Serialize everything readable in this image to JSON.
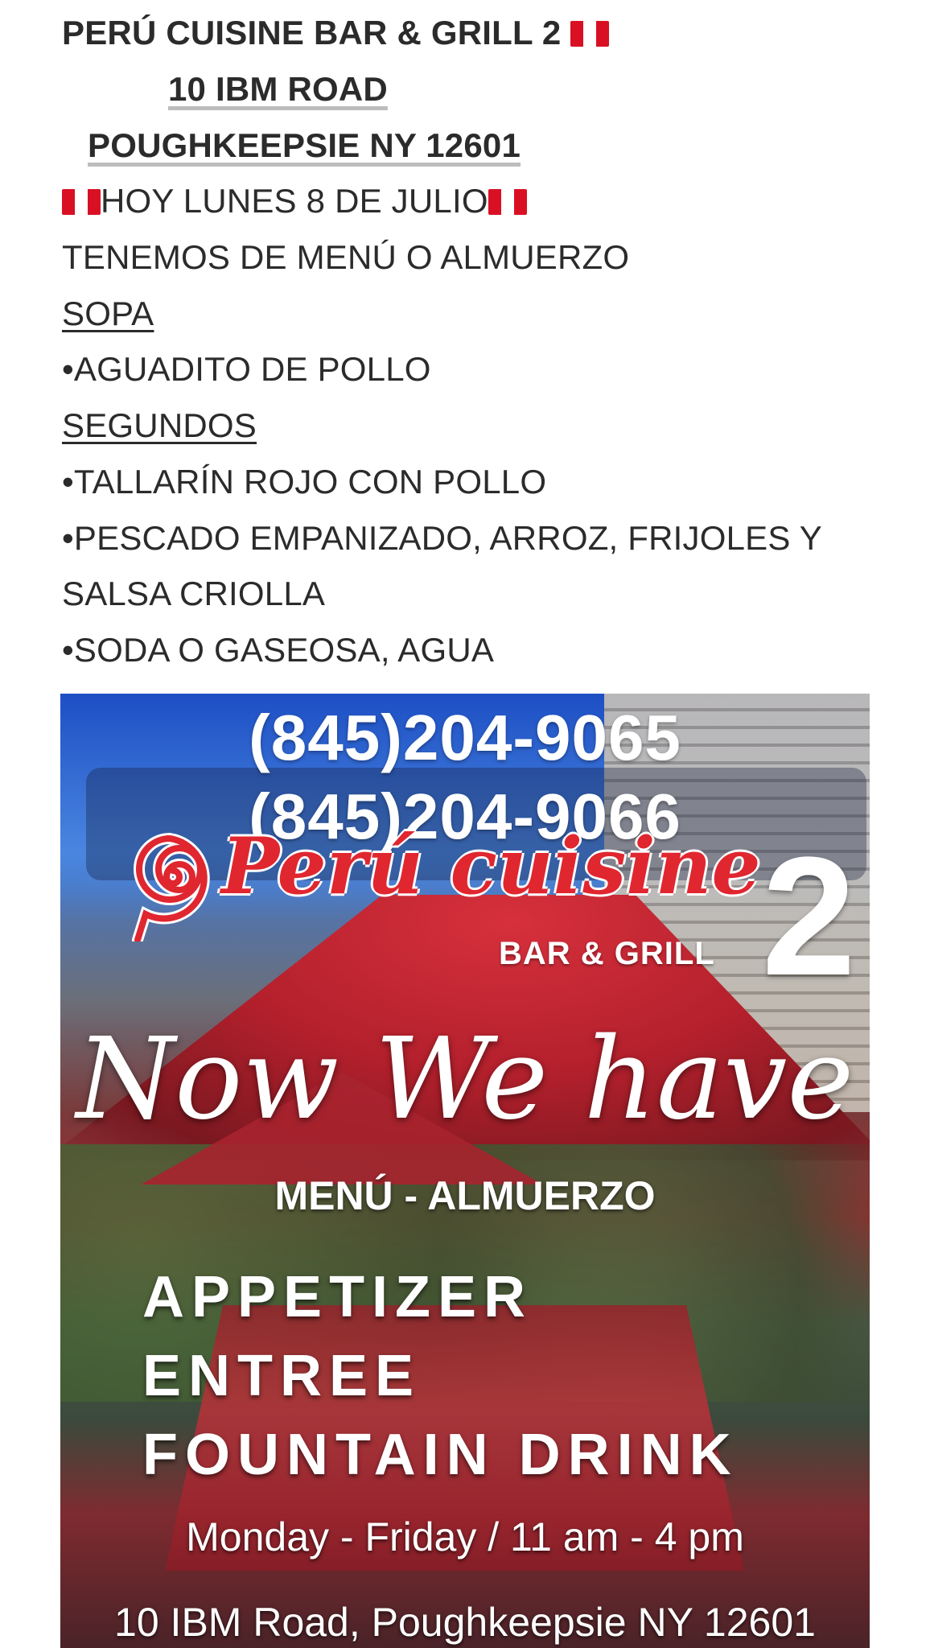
{
  "post": {
    "title": "PERÚ CUISINE BAR & GRILL 2",
    "address_line1": "10 IBM ROAD",
    "address_line2": "POUGHKEEPSIE NY 12601",
    "date_line": "HOY LUNES 8 DE JULIO",
    "intro": "TENEMOS DE MENÚ O ALMUERZO",
    "soup_heading": "SOPA",
    "soup_items": [
      "•AGUADITO DE POLLO"
    ],
    "seconds_heading": "SEGUNDOS",
    "seconds_items": [
      "•TALLARÍN ROJO CON POLLO",
      "•PESCADO EMPANIZADO, ARROZ, FRIJOLES Y",
      "SALSA CRIOLLA",
      "•SODA O GASEOSA, AGUA"
    ],
    "flag_icon": "peru-flag-icon"
  },
  "poster": {
    "phone1": "(845)204-9065",
    "phone2": "(845)204-9066",
    "logo_text": "Perú cuisine",
    "logo_sub": "BAR & GRILL",
    "logo_number": "2",
    "headline": "Now We have",
    "menu_label": "MENÚ - ALMUERZO",
    "features": [
      "APPETIZER",
      "ENTREE",
      "FOUNTAIN DRINK"
    ],
    "hours": "Monday - Friday / 11 am - 4 pm",
    "address": "10 IBM Road, Poughkeepsie NY 12601",
    "colors": {
      "brand_red": "#e0262f",
      "sky_blue": "#1f54c8"
    }
  }
}
